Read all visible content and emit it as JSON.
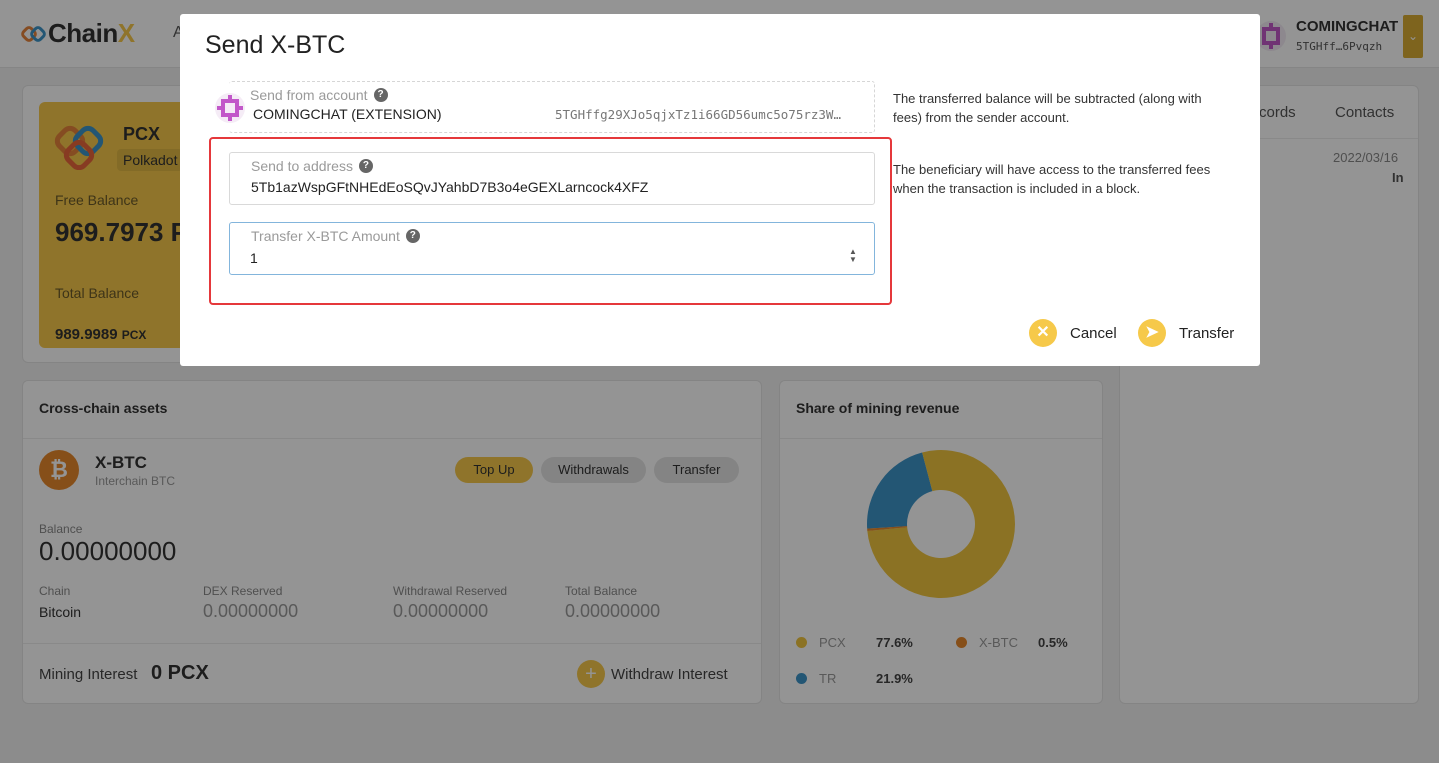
{
  "header": {
    "logo_chain": "Chain",
    "logo_x": "X",
    "nav_fragment": "A",
    "account_name": "COMINGCHAT",
    "account_addr": "5TGHff…6Pvqzh"
  },
  "pcx_card": {
    "token": "PCX",
    "tag": "Polkadot",
    "free_label": "Free Balance",
    "free_value": "969.7973 P",
    "total_label": "Total Balance",
    "total_value": "989.9989",
    "total_unit": "PCX"
  },
  "right_card": {
    "tab_records": "cords",
    "tab_contacts": "Contacts",
    "date": "2022/03/16",
    "direction": "In"
  },
  "cross_chain": {
    "title": "Cross-chain assets",
    "asset_name": "X-BTC",
    "asset_sub": "Interchain BTC",
    "btn_topup": "Top Up",
    "btn_withdrawals": "Withdrawals",
    "btn_transfer": "Transfer",
    "balance_label": "Balance",
    "balance_value": "0.00000000",
    "chain_label": "Chain",
    "chain_value": "Bitcoin",
    "dex_label": "DEX Reserved",
    "dex_value": "0.00000000",
    "wr_label": "Withdrawal Reserved",
    "wr_value": "0.00000000",
    "tb_label": "Total Balance",
    "tb_value": "0.00000000",
    "mining_interest_label": "Mining Interest",
    "mining_interest_value": "0 PCX",
    "withdraw_interest": "Withdraw Interest"
  },
  "mining": {
    "title": "Share of mining revenue",
    "legend": [
      {
        "name": "PCX",
        "pct": "77.6%",
        "color": "#f0c43f"
      },
      {
        "name": "X-BTC",
        "pct": "0.5%",
        "color": "#e7892c"
      },
      {
        "name": "TR",
        "pct": "21.9%",
        "color": "#3d94c8"
      }
    ],
    "shares": [
      77.6,
      0.5,
      21.9
    ]
  },
  "modal": {
    "title": "Send X-BTC",
    "from_label": "Send from account",
    "from_name": "COMINGCHAT (EXTENSION)",
    "from_addr": "5TGHffg29XJo5qjxTz1i66GD56umc5o75rz3W…",
    "to_label": "Send to address",
    "to_value": "5Tb1azWspGFtNHEdEoSQvJYahbD7B3o4eGEXLarncock4XFZ",
    "amount_label": "Transfer X-BTC Amount",
    "amount_value": "1",
    "hint_from": "The transferred balance will be subtracted (along with fees) from the sender account.",
    "hint_to": "The beneficiary will have access to the transferred fees when the transaction is included in a block.",
    "cancel_label": "Cancel",
    "transfer_label": "Transfer"
  }
}
